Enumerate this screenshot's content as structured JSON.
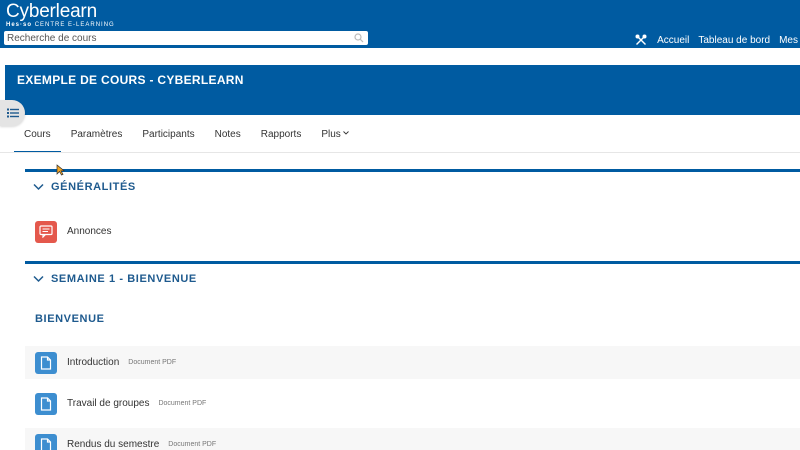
{
  "topbar": {
    "logo": {
      "main": "Cyberlearn",
      "sub_brand": "Hes·so",
      "sub_text": "CENTRE E-LEARNING"
    },
    "search": {
      "placeholder": "Recherche de cours"
    },
    "links": [
      "Accueil",
      "Tableau de bord",
      "Mes"
    ]
  },
  "course": {
    "title": "EXEMPLE DE COURS - CYBERLEARN"
  },
  "tabs": [
    {
      "label": "Cours",
      "active": true
    },
    {
      "label": "Paramètres"
    },
    {
      "label": "Participants"
    },
    {
      "label": "Notes"
    },
    {
      "label": "Rapports"
    },
    {
      "label": "Plus"
    }
  ],
  "sections": [
    {
      "title": "GÉNÉRALITÉS",
      "activities": [
        {
          "name": "Annonces",
          "type": "",
          "icon": "forum-icon"
        }
      ]
    },
    {
      "title": "SEMAINE 1 - BIENVENUE",
      "subheading": "BIENVENUE",
      "activities": [
        {
          "name": "Introduction",
          "type": "Document PDF",
          "icon": "file-icon"
        },
        {
          "name": "Travail de groupes",
          "type": "Document PDF",
          "icon": "file-icon"
        },
        {
          "name": "Rendus du semestre",
          "type": "Document PDF",
          "icon": "file-icon"
        }
      ]
    }
  ],
  "colors": {
    "brand": "#005ba1",
    "section_title": "#1e5a8e",
    "forum": "#e4584c",
    "file": "#3d8ed0"
  }
}
